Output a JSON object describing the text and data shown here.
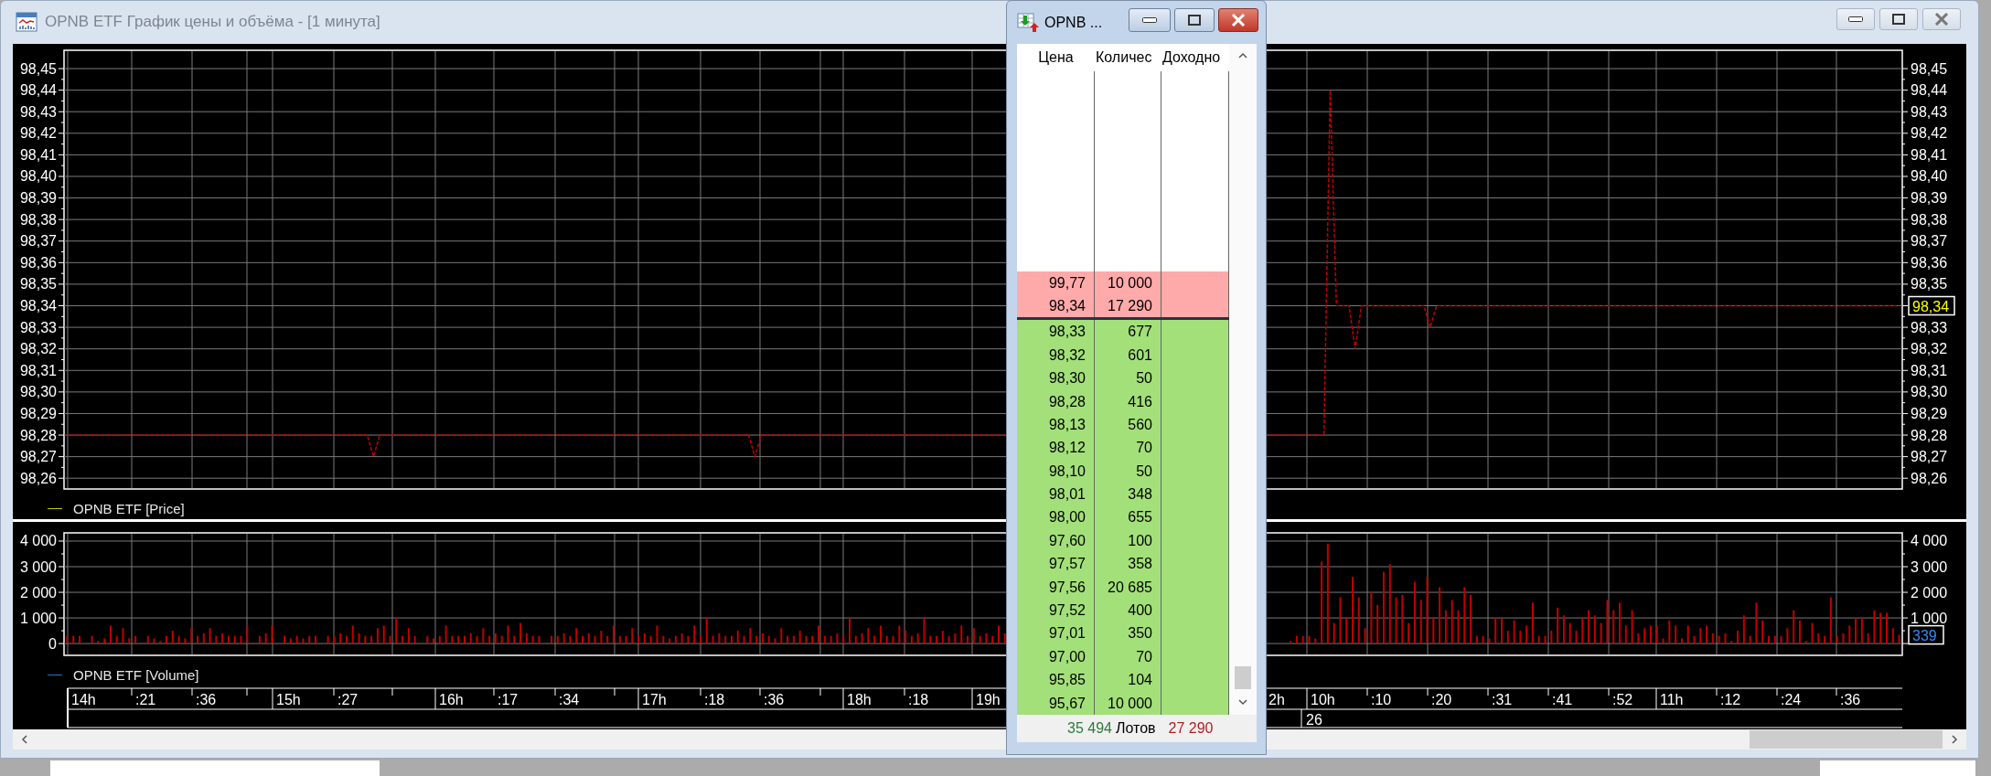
{
  "main_window": {
    "title": "OPNB ETF График цены и объёма - [1 минута]"
  },
  "price_chart": {
    "last_value": "98,34",
    "chart_data": {
      "type": "line",
      "grid": true,
      "yticks": [
        {
          "value": 98.45,
          "label": "98,45"
        },
        {
          "value": 98.44,
          "label": "98,44"
        },
        {
          "value": 98.43,
          "label": "98,43"
        },
        {
          "value": 98.42,
          "label": "98,42"
        },
        {
          "value": 98.41,
          "label": "98,41"
        },
        {
          "value": 98.4,
          "label": "98,40"
        },
        {
          "value": 98.39,
          "label": "98,39"
        },
        {
          "value": 98.38,
          "label": "98,38"
        },
        {
          "value": 98.37,
          "label": "98,37"
        },
        {
          "value": 98.36,
          "label": "98,36"
        },
        {
          "value": 98.35,
          "label": "98,35"
        },
        {
          "value": 98.34,
          "label": "98,34"
        },
        {
          "value": 98.33,
          "label": "98,33"
        },
        {
          "value": 98.32,
          "label": "98,32"
        },
        {
          "value": 98.31,
          "label": "98,31"
        },
        {
          "value": 98.3,
          "label": "98,30"
        },
        {
          "value": 98.29,
          "label": "98,29"
        },
        {
          "value": 98.28,
          "label": "98,28"
        },
        {
          "value": 98.27,
          "label": "98,27"
        },
        {
          "value": 98.26,
          "label": "98,26"
        }
      ],
      "ylim": [
        98.255,
        98.4585
      ],
      "series": [
        {
          "name": "OPNB ETF [Price]",
          "color": "#c00000",
          "line_style": "dashed",
          "values": [
            98.28,
            98.28,
            98.28,
            98.28,
            98.28,
            98.28,
            98.28,
            98.28,
            98.28,
            98.28,
            98.28,
            98.28,
            98.28,
            98.28,
            98.28,
            98.28,
            98.28,
            98.28,
            98.28,
            98.28,
            98.28,
            98.28,
            98.28,
            98.28,
            98.28,
            98.28,
            98.28,
            98.28,
            98.28,
            98.28,
            98.28,
            98.28,
            98.28,
            98.28,
            98.28,
            98.28,
            98.28,
            98.28,
            98.28,
            98.28,
            98.28,
            98.28,
            98.28,
            98.28,
            98.28,
            98.28,
            98.28,
            98.28,
            98.28,
            98.27,
            98.28,
            98.28,
            98.28,
            98.28,
            98.28,
            98.28,
            98.28,
            98.28,
            98.28,
            98.28,
            98.28,
            98.28,
            98.28,
            98.28,
            98.28,
            98.28,
            98.28,
            98.28,
            98.28,
            98.28,
            98.28,
            98.28,
            98.28,
            98.28,
            98.28,
            98.28,
            98.28,
            98.28,
            98.28,
            98.28,
            98.28,
            98.28,
            98.28,
            98.28,
            98.28,
            98.28,
            98.28,
            98.28,
            98.28,
            98.28,
            98.28,
            98.28,
            98.28,
            98.28,
            98.28,
            98.28,
            98.28,
            98.28,
            98.28,
            98.28,
            98.28,
            98.28,
            98.28,
            98.28,
            98.28,
            98.28,
            98.28,
            98.28,
            98.28,
            98.28,
            98.27,
            98.28,
            98.28,
            98.28,
            98.28,
            98.28,
            98.28,
            98.28,
            98.28,
            98.28,
            98.28,
            98.28,
            98.28,
            98.28,
            98.28,
            98.28,
            98.28,
            98.28,
            98.28,
            98.28,
            98.28,
            98.28,
            98.28,
            98.28,
            98.28,
            98.28,
            98.28,
            98.28,
            98.28,
            98.28,
            98.28,
            98.28,
            98.28,
            98.28,
            98.28,
            98.28,
            98.28,
            98.28,
            98.28,
            98.28,
            98.28,
            null,
            null,
            null,
            null,
            null,
            null,
            null,
            null,
            null,
            null,
            null,
            null,
            null,
            null,
            null,
            null,
            null,
            null,
            null,
            null,
            null,
            null,
            null,
            null,
            null,
            null,
            null,
            null,
            null,
            null,
            null,
            null,
            null,
            null,
            null,
            null,
            null,
            null,
            null,
            null,
            null,
            null,
            null,
            null,
            null,
            null,
            98.28,
            98.28,
            98.28,
            98.28,
            98.28,
            98.44,
            98.34,
            98.34,
            98.34,
            98.32,
            98.34,
            98.34,
            98.34,
            98.34,
            98.34,
            98.34,
            98.34,
            98.34,
            98.34,
            98.34,
            98.34,
            98.33,
            98.34,
            98.34,
            98.34,
            98.34,
            98.34,
            98.34,
            98.34,
            98.34,
            98.34,
            98.34,
            98.34,
            98.34,
            98.34,
            98.34,
            98.34,
            98.34,
            98.34,
            98.34,
            98.34,
            98.34,
            98.34,
            98.34,
            98.34,
            98.34,
            98.34,
            98.34,
            98.34,
            98.34,
            98.34,
            98.34,
            98.34,
            98.34,
            98.34,
            98.34,
            98.34,
            98.34,
            98.34,
            98.34,
            98.34,
            98.34,
            98.34,
            98.34,
            98.34,
            98.34,
            98.34,
            98.34,
            98.34,
            98.34,
            98.34,
            98.34,
            98.34,
            98.34,
            98.34,
            98.34,
            98.34,
            98.34,
            98.34,
            98.34,
            98.34,
            98.34,
            98.34,
            98.34,
            98.34,
            98.34,
            98.34,
            98.34,
            98.34,
            98.34,
            98.34,
            98.34,
            98.34,
            98.34,
            98.34,
            98.34,
            98.34
          ]
        }
      ]
    }
  },
  "volume_chart": {
    "last_value": "339",
    "chart_data": {
      "type": "bar",
      "grid": true,
      "yticks": [
        {
          "value": 4000,
          "label": "4 000"
        },
        {
          "value": 3000,
          "label": "3 000"
        },
        {
          "value": 2000,
          "label": "2 000"
        },
        {
          "value": 1000,
          "label": "1 000"
        },
        0
      ],
      "ylim": [
        -460,
        4320
      ],
      "series": [
        {
          "name": "OPNB ETF [Volume]",
          "color": "#c00000",
          "values": [
            300,
            300,
            300,
            null,
            300,
            100,
            200,
            700,
            300,
            600,
            200,
            300,
            null,
            300,
            200,
            100,
            300,
            500,
            300,
            200,
            600,
            300,
            400,
            600,
            300,
            400,
            300,
            300,
            300,
            700,
            null,
            300,
            400,
            700,
            null,
            300,
            200,
            300,
            200,
            300,
            300,
            null,
            300,
            300,
            400,
            300,
            700,
            400,
            300,
            300,
            600,
            700,
            300,
            1000,
            300,
            600,
            300,
            null,
            300,
            200,
            300,
            700,
            300,
            300,
            300,
            400,
            300,
            600,
            300,
            400,
            300,
            700,
            300,
            800,
            400,
            300,
            300,
            null,
            300,
            300,
            400,
            300,
            600,
            300,
            400,
            300,
            500,
            300,
            700,
            300,
            300,
            600,
            300,
            400,
            300,
            700,
            300,
            200,
            300,
            400,
            300,
            700,
            300,
            1000,
            300,
            400,
            300,
            300,
            500,
            300,
            600,
            300,
            400,
            300,
            200,
            600,
            300,
            300,
            500,
            300,
            300,
            700,
            300,
            300,
            400,
            300,
            1000,
            300,
            400,
            600,
            300,
            700,
            300,
            300,
            700,
            500,
            300,
            400,
            1000,
            300,
            300,
            500,
            300,
            400,
            700,
            300,
            600,
            300,
            400,
            300,
            700,
            400,
            null,
            null,
            null,
            null,
            null,
            null,
            null,
            null,
            null,
            null,
            null,
            null,
            null,
            null,
            null,
            null,
            null,
            null,
            null,
            null,
            null,
            null,
            null,
            null,
            null,
            null,
            null,
            null,
            null,
            null,
            null,
            null,
            null,
            null,
            null,
            null,
            null,
            null,
            null,
            null,
            null,
            null,
            null,
            null,
            null,
            100,
            300,
            300,
            300,
            200,
            3200,
            3900,
            800,
            1800,
            1000,
            2600,
            1800,
            600,
            2000,
            1500,
            2800,
            3100,
            1800,
            1900,
            800,
            2400,
            1700,
            2600,
            1000,
            2200,
            1300,
            1700,
            1300,
            2200,
            1900,
            300,
            300,
            200,
            1000,
            1000,
            500,
            900,
            500,
            700,
            1600,
            300,
            300,
            500,
            1400,
            1100,
            800,
            500,
            1000,
            1300,
            1100,
            800,
            1700,
            1300,
            1600,
            700,
            1300,
            400,
            600,
            700,
            700,
            200,
            900,
            700,
            200,
            700,
            300,
            600,
            700,
            400,
            300,
            400,
            100,
            500,
            1100,
            300,
            1600,
            900,
            300,
            300,
            300,
            600,
            1300,
            900,
            100,
            800,
            400,
            300,
            1800,
            300,
            400,
            700,
            1000,
            1000,
            400,
            1300,
            1200,
            1200,
            600,
            339
          ]
        }
      ]
    }
  },
  "time_axis": {
    "ticks": [
      {
        "label": "14h",
        "major": true
      },
      {
        "label": ":21",
        "major": false
      },
      {
        "label": ":36",
        "major": false
      },
      {
        "label": "15h",
        "major": true
      },
      {
        "label": ":27",
        "major": false
      },
      {
        "label": "16h",
        "major": true
      },
      {
        "label": ":17",
        "major": false
      },
      {
        "label": ":34",
        "major": false
      },
      {
        "label": "17h",
        "major": true
      },
      {
        "label": ":18",
        "major": false
      },
      {
        "label": ":36",
        "major": false
      },
      {
        "label": "18h",
        "major": true
      },
      {
        "label": ":18",
        "major": false
      },
      {
        "label": "19h",
        "major": true
      },
      {
        "label": "2h",
        "major": true
      },
      {
        "label": "10h",
        "major": true
      },
      {
        "label": ":10",
        "major": false
      },
      {
        "label": ":20",
        "major": false
      },
      {
        "label": ":31",
        "major": false
      },
      {
        "label": ":41",
        "major": false
      },
      {
        "label": ":52",
        "major": false
      },
      {
        "label": "11h",
        "major": true
      },
      {
        "label": ":12",
        "major": false
      },
      {
        "label": ":24",
        "major": false
      },
      {
        "label": ":36",
        "major": false
      }
    ],
    "dates": [
      "26"
    ]
  },
  "order_book": {
    "title": "OPNB ...",
    "columns": [
      "Цена",
      "Количес",
      "Доходно"
    ],
    "asks": [
      {
        "price": "99,77",
        "quantity": "10 000"
      },
      {
        "price": "98,34",
        "quantity": "17 290"
      }
    ],
    "bids": [
      {
        "price": "98,33",
        "quantity": "677"
      },
      {
        "price": "98,32",
        "quantity": "601"
      },
      {
        "price": "98,30",
        "quantity": "50"
      },
      {
        "price": "98,28",
        "quantity": "416"
      },
      {
        "price": "98,13",
        "quantity": "560"
      },
      {
        "price": "98,12",
        "quantity": "70"
      },
      {
        "price": "98,10",
        "quantity": "50"
      },
      {
        "price": "98,01",
        "quantity": "348"
      },
      {
        "price": "98,00",
        "quantity": "655"
      },
      {
        "price": "97,60",
        "quantity": "100"
      },
      {
        "price": "97,57",
        "quantity": "358"
      },
      {
        "price": "97,56",
        "quantity": "20 685"
      },
      {
        "price": "97,52",
        "quantity": "400"
      },
      {
        "price": "97,01",
        "quantity": "350"
      },
      {
        "price": "97,00",
        "quantity": "70"
      },
      {
        "price": "95,85",
        "quantity": "104"
      },
      {
        "price": "95,67",
        "quantity": "10 000"
      }
    ],
    "footer": {
      "bid_total": "35 494",
      "unit": "Лотов",
      "ask_total": "27 290"
    }
  }
}
